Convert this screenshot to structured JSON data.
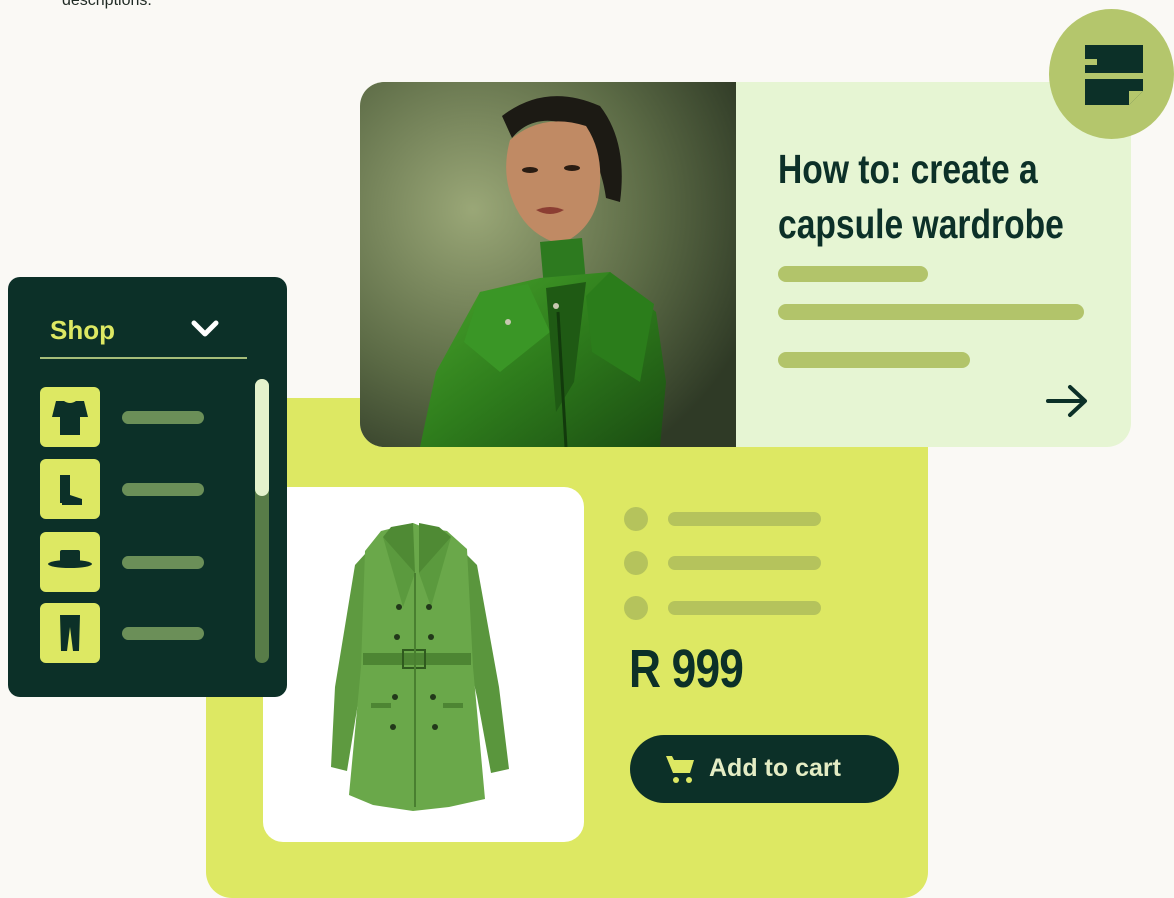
{
  "header": {
    "fragment_text": "descriptions."
  },
  "article": {
    "title_line1": "How to: create a",
    "title_line2": "capsule wardrobe",
    "photo_icon": "woman-green-leather-coat-photo",
    "badge_icon": "document-lines-icon",
    "arrow_icon": "arrow-right-icon"
  },
  "product": {
    "image_icon": "green-trench-coat-photo",
    "price": "R 999",
    "add_to_cart_label": "Add to cart",
    "cart_icon": "shopping-cart-icon"
  },
  "sidebar": {
    "title": "Shop",
    "toggle_icon": "chevron-down-icon",
    "items": [
      {
        "icon": "tshirt-icon"
      },
      {
        "icon": "boot-icon"
      },
      {
        "icon": "hat-icon"
      },
      {
        "icon": "trousers-icon"
      }
    ]
  },
  "colors": {
    "dark_green": "#0c3028",
    "lime": "#dde863",
    "pale_green": "#e6f5d3",
    "muted_green": "#b2c46a",
    "background": "#faf9f5"
  }
}
